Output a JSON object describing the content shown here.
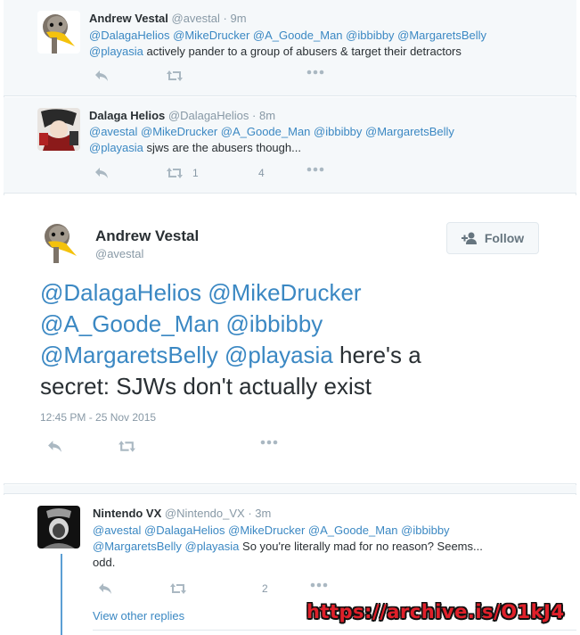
{
  "tweet1": {
    "name": "Andrew Vestal",
    "handle": "@avestal",
    "time": "9m",
    "mentions": "@DalagaHelios @MikeDrucker @A_Goode_Man @ibbibby @MargaretsBelly",
    "mention_last": "@playasia",
    "text": " actively pander to a group of abusers & target their detractors"
  },
  "tweet2": {
    "name": "Dalaga Helios",
    "handle": "@DalagaHelios",
    "time": "8m",
    "mentions": "@avestal @MikeDrucker @A_Goode_Man @ibbibby @MargaretsBelly",
    "mention_last": "@playasia",
    "text": " sjws are the abusers though...",
    "retweet_count": "1",
    "like_count": "4"
  },
  "main_tweet": {
    "name": "Andrew Vestal",
    "handle": "@avestal",
    "follow_label": "Follow",
    "line1_mentions": "@DalagaHelios @MikeDrucker",
    "line2_mentions": "@A_Goode_Man @ibbibby",
    "line3_mentions": "@MargaretsBelly @playasia",
    "line3_text": " here's a",
    "line4_text": "secret: SJWs don't actually exist",
    "timestamp": "12:45 PM - 25 Nov 2015"
  },
  "reply": {
    "name": "Nintendo VX",
    "handle": "@Nintendo_VX",
    "time": "3m",
    "mentions": "@avestal @DalagaHelios @MikeDrucker @A_Goode_Man @ibbibby",
    "mentions2": "@MargaretsBelly @playasia",
    "text": " So you're literally mad for no reason? Seems...",
    "text2": "odd.",
    "like_count": "2",
    "view_more": "View other replies"
  },
  "watermark": "https://archive.is/O1kJ4",
  "colors": {
    "link": "#3b88c3",
    "muted": "#8899a6",
    "background": "#f5f8fa",
    "watermark": "#e0202a"
  }
}
